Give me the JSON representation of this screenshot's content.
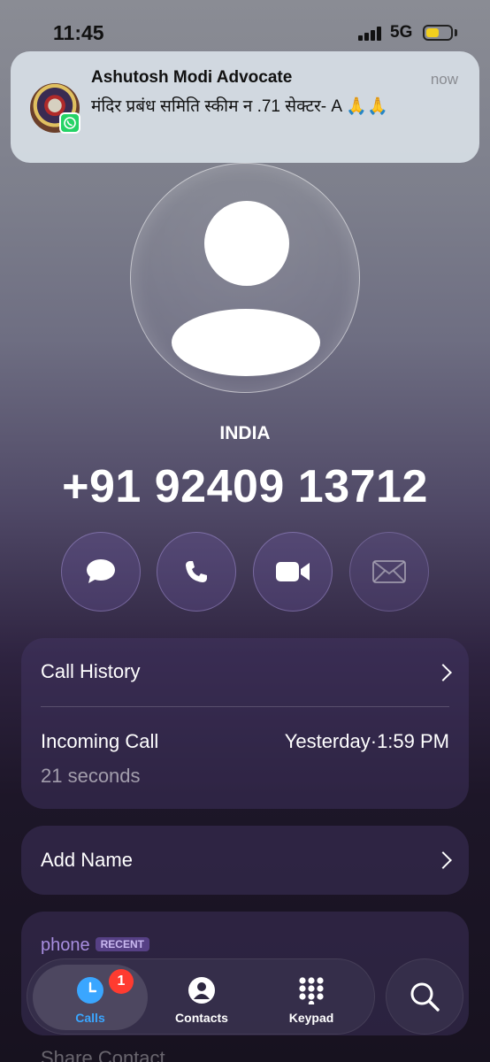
{
  "status_bar": {
    "time": "11:45",
    "network": "5G",
    "battery_level": 0.55,
    "battery_color": "#f2cf1e"
  },
  "notification": {
    "app_icon": "whatsapp-icon",
    "sender": "Ashutosh Modi Advocate",
    "time": "now",
    "message": "मंदिर प्रबंध समिति स्कीम न .71  सेक्टर- A 🙏🙏"
  },
  "contact": {
    "avatar_icon": "person-placeholder-icon",
    "country": "INDIA",
    "number": "+91 92409 13712"
  },
  "actions": [
    {
      "icon": "message-icon",
      "enabled": true
    },
    {
      "icon": "phone-icon",
      "enabled": true
    },
    {
      "icon": "video-icon",
      "enabled": true
    },
    {
      "icon": "mail-icon",
      "enabled": false
    }
  ],
  "call_history": {
    "title": "Call History",
    "entry": {
      "type": "Incoming Call",
      "date": "Yesterday",
      "separator": "·",
      "time": "1:59 PM",
      "duration": "21 seconds"
    }
  },
  "add_name": {
    "label": "Add Name"
  },
  "phone_card": {
    "label": "phone",
    "badge": "RECENT"
  },
  "share_contact": {
    "label": "Share Contact"
  },
  "tabbar": {
    "tabs": [
      {
        "label": "Calls",
        "icon": "clock-icon",
        "active": true,
        "badge": "1"
      },
      {
        "label": "Contacts",
        "icon": "person-circle-icon",
        "active": false
      },
      {
        "label": "Keypad",
        "icon": "keypad-icon",
        "active": false
      }
    ],
    "search_icon": "search-icon"
  },
  "colors": {
    "accent_blue": "#3aa6ff",
    "badge_red": "#ff3b30",
    "whatsapp_green": "#25d366"
  }
}
